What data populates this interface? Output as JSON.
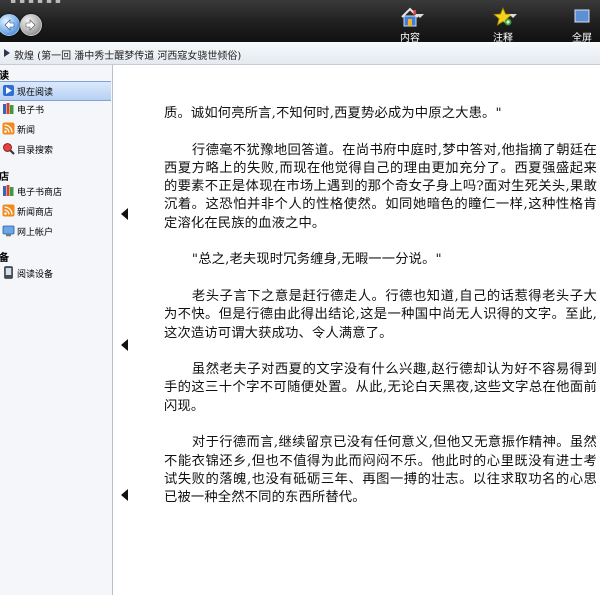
{
  "toolbar": {
    "menu_fragment": "▪ ▪ ▪ ▪ ▪ ▪",
    "content_label": "内容",
    "annotation_label": "注释",
    "fullscreen_label": "全屏"
  },
  "breadcrumb": {
    "text": "敦煌 (第一回 潘中秀士醒梦传道 河西寇女骁世倾俗)"
  },
  "sidebar": {
    "sections": [
      {
        "label": "阅读",
        "items": [
          {
            "label": "现在阅读",
            "icon": "reading-icon",
            "selected": true
          },
          {
            "label": "电子书",
            "icon": "ebook-icon"
          },
          {
            "label": "新闻",
            "icon": "news-rss-icon"
          },
          {
            "label": "目录搜索",
            "icon": "catalog-search-icon"
          }
        ]
      },
      {
        "label": "商店",
        "items": [
          {
            "label": "电子书商店",
            "icon": "ebook-store-icon"
          },
          {
            "label": "新闻商店",
            "icon": "news-store-icon"
          },
          {
            "label": "网上帐户",
            "icon": "online-account-icon"
          }
        ]
      },
      {
        "label": "设备",
        "items": [
          {
            "label": "阅读设备",
            "icon": "reading-device-icon"
          }
        ]
      }
    ]
  },
  "reader": {
    "paragraphs": [
      {
        "text": "质。诚如何亮所言,不知何时,西夏势必成为中原之大患。\"",
        "indent": false
      },
      {
        "text": "行德毫不犹豫地回答道。在尚书府中庭时,梦中答对,他指摘了朝廷在西夏方略上的失败,而现在他觉得自己的理由更加充分了。西夏强盛起来的要素不正是体现在市场上遇到的那个奇女子身上吗?面对生死关头,果敢沉着。这恐怕并非个人的性格使然。如同她暗色的瞳仁一样,这种性格肯定溶化在民族的血液之中。",
        "indent": true
      },
      {
        "text": "\"总之,老夫现时冗务缠身,无暇一一分说。\"",
        "indent": true
      },
      {
        "text": "老头子言下之意是赶行德走人。行德也知道,自己的话惹得老头子大为不快。但是行德由此得出结论,这是一种国中尚无人识得的文字。至此,这次造访可谓大获成功、令人满意了。",
        "indent": true
      },
      {
        "text": "虽然老夫子对西夏的文字没有什么兴趣,赵行德却认为好不容易得到手的这三十个字不可随便处置。从此,无论白天黑夜,这些文字总在他面前闪现。",
        "indent": true
      },
      {
        "text": "对于行德而言,继续留京已没有任何意义,但他又无意振作精神。虽然不能衣锦还乡,但也不值得为此而闷闷不乐。他此时的心里既没有进士考试失败的落魄,也没有砥砺三年、再图一搏的壮志。以往求取功名的心思已被一种全然不同的东西所替代。",
        "indent": true
      }
    ]
  }
}
